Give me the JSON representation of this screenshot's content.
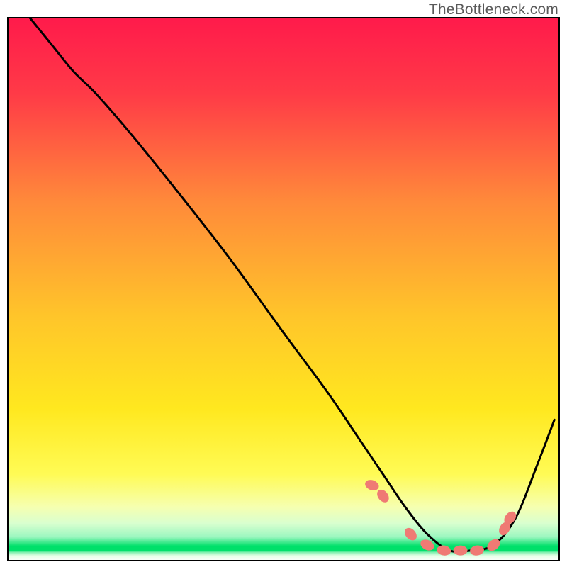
{
  "watermark": "TheBottleneck.com",
  "chart_data": {
    "type": "line",
    "title": "",
    "xlabel": "",
    "ylabel": "",
    "xlim": [
      0,
      100
    ],
    "ylim": [
      0,
      100
    ],
    "grid": false,
    "background_gradient": {
      "top_color": "#ff1a4b",
      "mid_color": "#ffd400",
      "bottom_edge_color": "#00e06a"
    },
    "series": [
      {
        "name": "bottleneck-curve",
        "color": "#000000",
        "x": [
          4,
          8,
          12,
          16,
          22,
          30,
          40,
          50,
          58,
          64,
          68,
          72,
          76,
          80,
          84,
          88,
          92,
          96,
          99
        ],
        "y": [
          100,
          95,
          90,
          86,
          79,
          69,
          56,
          42,
          31,
          22,
          16,
          10,
          5,
          2,
          2,
          3,
          8,
          18,
          26
        ]
      }
    ],
    "markers": {
      "name": "highlight-points",
      "color": "#ef7a74",
      "x": [
        66,
        68,
        73,
        76,
        79,
        82,
        85,
        88,
        90,
        91
      ],
      "y": [
        14,
        12,
        5,
        3,
        2,
        2,
        2,
        3,
        6,
        8
      ]
    }
  }
}
